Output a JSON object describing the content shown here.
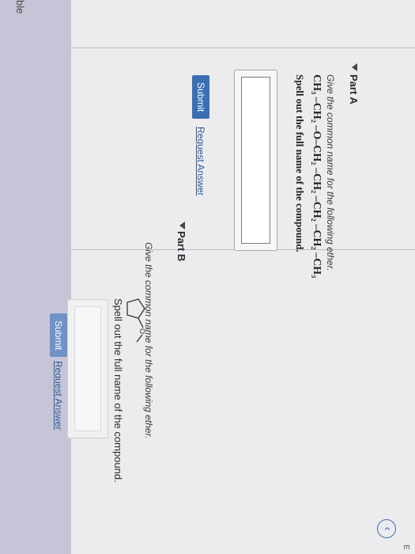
{
  "nav": {
    "truncated_label": "ble"
  },
  "header": {
    "back_icon": "chevron-left-icon",
    "corner_text": "E"
  },
  "part_a": {
    "title": "Part A",
    "question": "Give the common name for the following ether.",
    "formula": "CH₃ –CH₂ –O–CH₂ –CH₂ –CH₂ –CH₂ –CH₃",
    "instruction": "Spell out the full name of the compound.",
    "answer_value": "",
    "submit_label": "Submit",
    "request_label": "Request Answer"
  },
  "part_b": {
    "title": "Part B",
    "question": "Give the common name for the following ether.",
    "structure_label": "O",
    "instruction": "Spell out the full name of the compound.",
    "answer_value": "",
    "submit_label": "Submit",
    "request_label": "Request Answer"
  },
  "colors": {
    "accent": "#3b6fb4",
    "nav_strip": "#c6c5d8",
    "background": "#ececee"
  }
}
